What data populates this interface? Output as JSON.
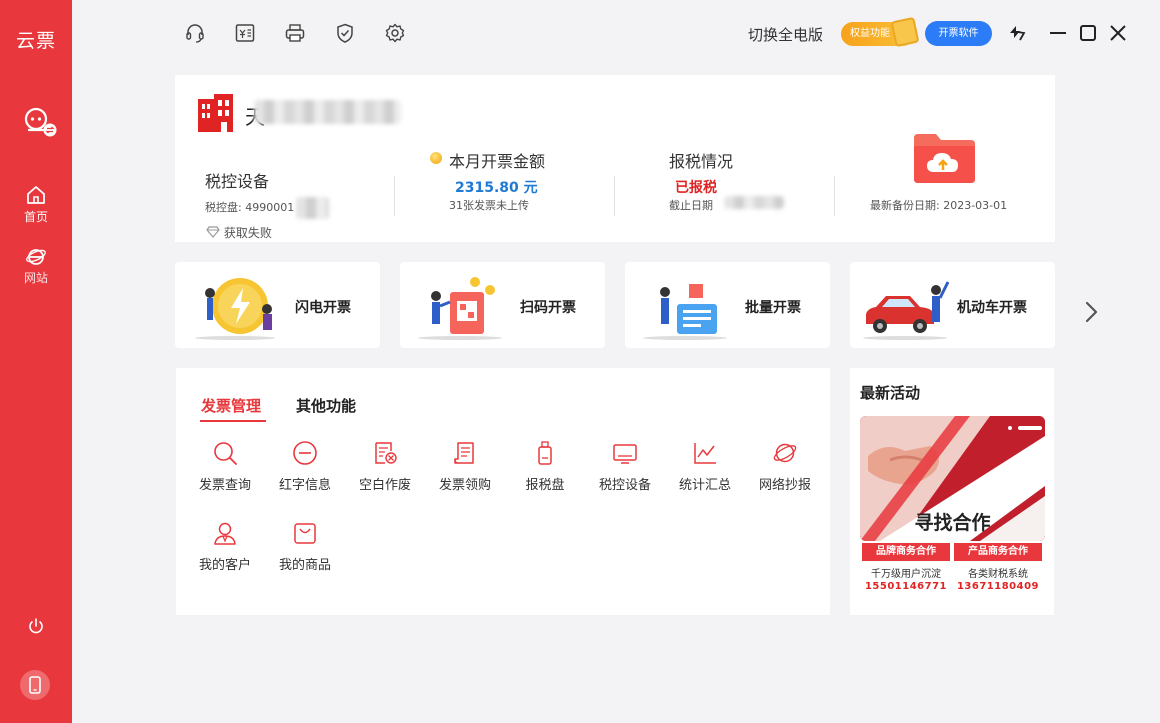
{
  "app": {
    "logo": "云票"
  },
  "sidebar": {
    "items": [
      {
        "label": "首页",
        "icon": "home-icon"
      },
      {
        "label": "网站",
        "icon": "ie-browser-icon"
      }
    ]
  },
  "topbar": {
    "icons": [
      "headset-icon",
      "invoice-icon",
      "printer-icon",
      "shield-icon",
      "gear-icon"
    ],
    "switch_label": "切换全电版",
    "rights_label": "权益功能",
    "software_label": "开票软件"
  },
  "company": {
    "name_prefix": "天"
  },
  "device": {
    "title": "税控设备",
    "disk_label": "税控盘: 4990001",
    "status": "获取失败"
  },
  "invoice_month": {
    "title": "本月开票金额",
    "amount": "2315.80 元",
    "note": "31张发票未上传"
  },
  "tax": {
    "title": "报税情况",
    "status": "已报税",
    "deadline_label": "截止日期"
  },
  "backup": {
    "label": "最新备份日期: 2023-03-01"
  },
  "quick_actions": [
    {
      "label": "闪电开票"
    },
    {
      "label": "扫码开票"
    },
    {
      "label": "批量开票"
    },
    {
      "label": "机动车开票"
    }
  ],
  "tabs": [
    {
      "label": "发票管理",
      "active": true
    },
    {
      "label": "其他功能",
      "active": false
    }
  ],
  "functions": [
    {
      "label": "发票查询",
      "icon": "search-icon"
    },
    {
      "label": "红字信息",
      "icon": "minus-circle-icon"
    },
    {
      "label": "空白作废",
      "icon": "void-invoice-icon"
    },
    {
      "label": "发票领购",
      "icon": "receipt-icon"
    },
    {
      "label": "报税盘",
      "icon": "usb-key-icon"
    },
    {
      "label": "税控设备",
      "icon": "device-icon"
    },
    {
      "label": "统计汇总",
      "icon": "chart-icon"
    },
    {
      "label": "网络抄报",
      "icon": "globe-icon"
    },
    {
      "label": "我的客户",
      "icon": "user-icon"
    },
    {
      "label": "我的商品",
      "icon": "bag-icon"
    }
  ],
  "promo": {
    "title": "最新活动",
    "banner_title": "寻找合作",
    "cooperation": [
      {
        "button": "品牌商务合作",
        "desc": "千万级用户沉淀",
        "phone": "15501146771"
      },
      {
        "button": "产品商务合作",
        "desc": "各类财税系统",
        "phone": "13671180409"
      }
    ]
  },
  "colors": {
    "brand_red": "#e8383d",
    "accent_blue": "#2b7cf6",
    "accent_orange": "#f7a21a"
  }
}
